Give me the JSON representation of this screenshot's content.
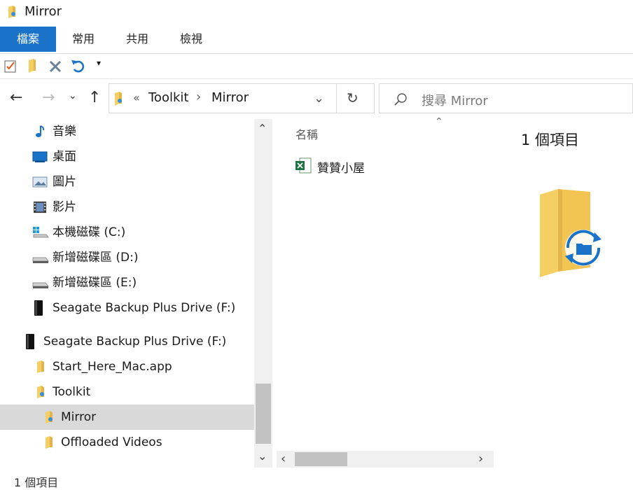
{
  "window": {
    "title": "Mirror"
  },
  "ribbon": {
    "tabs": [
      "檔案",
      "常用",
      "共用",
      "檢視"
    ]
  },
  "nav": {
    "back_glyph": "←",
    "forward_glyph": "→",
    "recent_glyph": "⌄",
    "up_glyph": "↑",
    "breadcrumb_sep0": "«",
    "breadcrumb": [
      "Toolkit",
      "Mirror"
    ],
    "breadcrumb_sep": "›",
    "dropdown_glyph": "⌄",
    "refresh_glyph": "↻"
  },
  "search": {
    "placeholder": "搜尋 Mirror"
  },
  "tree": {
    "items": [
      {
        "label": "音樂",
        "icon": "music-icon"
      },
      {
        "label": "桌面",
        "icon": "desktop-icon"
      },
      {
        "label": "圖片",
        "icon": "pictures-icon"
      },
      {
        "label": "影片",
        "icon": "videos-icon"
      },
      {
        "label": "本機磁碟 (C:)",
        "icon": "windows-drive-icon"
      },
      {
        "label": "新增磁碟區 (D:)",
        "icon": "drive-icon"
      },
      {
        "label": "新增磁碟區 (E:)",
        "icon": "drive-icon"
      },
      {
        "label": "Seagate Backup Plus Drive (F:)",
        "icon": "external-drive-icon"
      },
      {
        "label": "Seagate Backup Plus Drive (F:)",
        "icon": "external-drive-icon"
      },
      {
        "label": "Start_Here_Mac.app",
        "icon": "folder-icon"
      },
      {
        "label": "Toolkit",
        "icon": "toolkit-folder-icon"
      },
      {
        "label": "Mirror",
        "icon": "mirror-folder-icon",
        "selected": true
      },
      {
        "label": "Offloaded Videos",
        "icon": "folder-icon"
      }
    ],
    "scroll_up_glyph": "⌃",
    "scroll_down_glyph": "⌄"
  },
  "content": {
    "column_header": "名稱",
    "sort_glyph": "⌃",
    "files": [
      {
        "name": "贊贊小屋",
        "icon": "excel-file-icon"
      }
    ],
    "hscroll_left_glyph": "‹",
    "hscroll_right_glyph": "›"
  },
  "details": {
    "count_text": "1 個項目"
  },
  "status": {
    "text": "1 個項目"
  },
  "colors": {
    "accent": "#1a73c8",
    "selected_bg": "#d9d9d9",
    "folder": "#f6cf62"
  }
}
